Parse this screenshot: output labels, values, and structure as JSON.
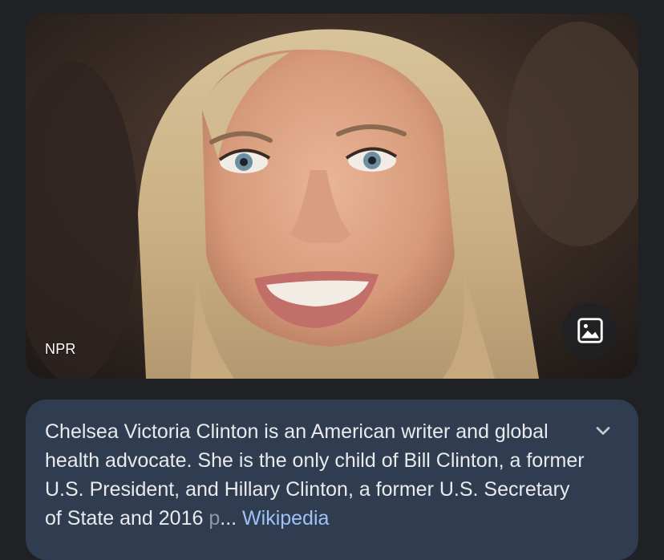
{
  "image_card": {
    "source": "NPR",
    "image_button_icon": "image-icon"
  },
  "description": {
    "text": "Chelsea Victoria Clinton is an American writer and global health advocate. She is the only child of Bill Clinton, a former U.S. President, and Hillary Clinton, a former U.S. Secretary of State and 2016 ",
    "faded": "p",
    "ellipsis": "...",
    "link_label": "Wikipedia",
    "expand_icon": "chevron-down-icon"
  }
}
